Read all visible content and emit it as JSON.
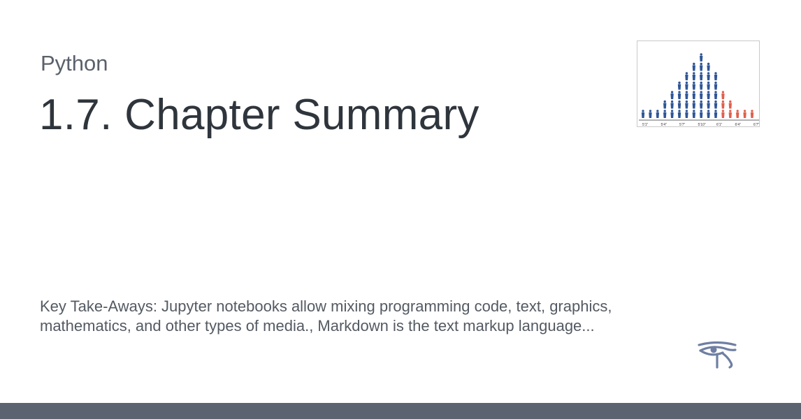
{
  "header": {
    "site_name": "Python",
    "page_title": "1.7. Chapter Summary"
  },
  "thumbnail": {
    "tick_labels": [
      "5'1\"",
      "5'4\"",
      "5'7\"",
      "5'10\"",
      "6'1\"",
      "6'4\"",
      "6'7\""
    ],
    "colors": {
      "below": "#2f5597",
      "above": "#e0604d"
    }
  },
  "description": {
    "text": "Key Take-Aways: Jupyter notebooks allow mixing programming code, text, graphics, mathematics, and other types of media., Markdown is the text markup language..."
  },
  "logo": {
    "icon": "eye-of-horus-icon",
    "color": "#6f7fa3"
  },
  "footer": {
    "color": "#5c6370"
  }
}
